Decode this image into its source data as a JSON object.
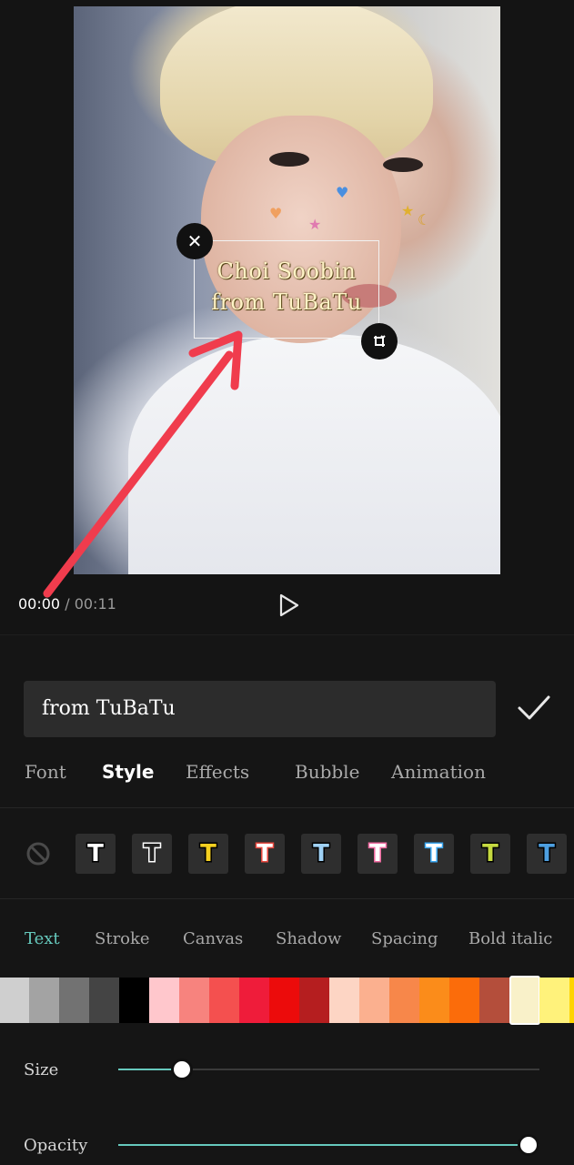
{
  "overlay_text": {
    "line1": "Choi Soobin",
    "line2": "from TuBaTu"
  },
  "playback": {
    "current": "00:00",
    "separator": "/",
    "duration": "00:11"
  },
  "text_input": {
    "value": "from TuBaTu"
  },
  "tabs": [
    "Font",
    "Style",
    "Effects",
    "Bubble",
    "Animation"
  ],
  "active_tab": "Style",
  "style_presets": [
    {
      "glyph": "T",
      "fill": "#ffffff",
      "stroke": "#000000"
    },
    {
      "glyph": "T",
      "fill": "#222222",
      "stroke": "#ffffff"
    },
    {
      "glyph": "T",
      "fill": "#f5d020",
      "stroke": "#000000"
    },
    {
      "glyph": "T",
      "fill": "#ffffff",
      "stroke": "#e8483f"
    },
    {
      "glyph": "T",
      "fill": "#9fd1f5",
      "stroke": "#000000"
    },
    {
      "glyph": "T",
      "fill": "#ffffff",
      "stroke": "#f06aa0"
    },
    {
      "glyph": "T",
      "fill": "#ffffff",
      "stroke": "#3aa7f0"
    },
    {
      "glyph": "T",
      "fill": "#c5d940",
      "stroke": "#000000"
    },
    {
      "glyph": "T",
      "fill": "#4d9fe0",
      "stroke": "#000000"
    }
  ],
  "subtabs": [
    "Text",
    "Stroke",
    "Canvas",
    "Shadow",
    "Spacing",
    "Bold italic"
  ],
  "active_subtab": "Text",
  "palette": [
    "#cfcfcf",
    "#a3a3a3",
    "#727272",
    "#444444",
    "#000000",
    "#ffc7cc",
    "#f7837e",
    "#f4504f",
    "#ef1c3a",
    "#ec0b0b",
    "#b51e1f",
    "#fdd5c4",
    "#fbb08f",
    "#f7874a",
    "#fb8c1a",
    "#fb6c0a",
    "#b44e3b",
    "#f9f1c9",
    "#fff27b",
    "#ffd400"
  ],
  "selected_color_index": 17,
  "sliders": [
    {
      "label": "Size",
      "value": 0.15
    },
    {
      "label": "Opacity",
      "value": 1.0
    }
  ],
  "colors": {
    "accent": "#66c9bd",
    "arrow": "#f03c4d"
  }
}
